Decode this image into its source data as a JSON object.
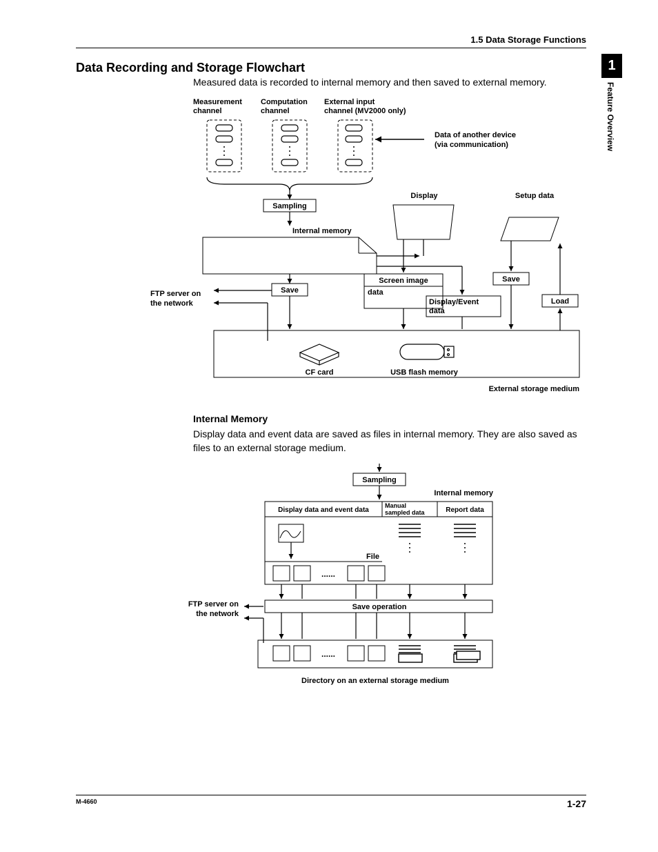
{
  "header": {
    "section": "1.5  Data Storage Functions"
  },
  "sidebar": {
    "chapter": "1",
    "title": "Feature Overview"
  },
  "title": "Data Recording and Storage Flowchart",
  "intro": "Measured data is recorded to internal memory and then saved to external memory.",
  "diagram1": {
    "col_meas": "Measurement channel",
    "col_comp": "Computation channel",
    "col_ext": "External input channel (MV2000 only)",
    "data_of_another": "Data of another device (via communication)",
    "sampling": "Sampling",
    "display": "Display",
    "setup_data": "Setup data",
    "internal_memory": "Internal memory",
    "save": "Save",
    "save2": "Save",
    "load": "Load",
    "ftp": "FTP server on the network",
    "screen_image": "Screen image data",
    "display_event": "Display/Event data",
    "cf_card": "CF card",
    "usb": "USB flash memory",
    "ext_storage": "External storage medium"
  },
  "sub": {
    "title": "Internal Memory",
    "body": "Display data and event data are saved as files in internal memory. They are also saved as files to an external storage medium."
  },
  "diagram2": {
    "sampling": "Sampling",
    "internal_memory": "Internal memory",
    "display_event": "Display data and event data",
    "manual": "Manual sampled data",
    "report": "Report data",
    "file": "File",
    "dots": "......",
    "save_op": "Save operation",
    "ftp": "FTP server on the network",
    "directory": "Directory on an external storage medium"
  },
  "footer": {
    "left": "M-4660",
    "right": "1-27"
  }
}
